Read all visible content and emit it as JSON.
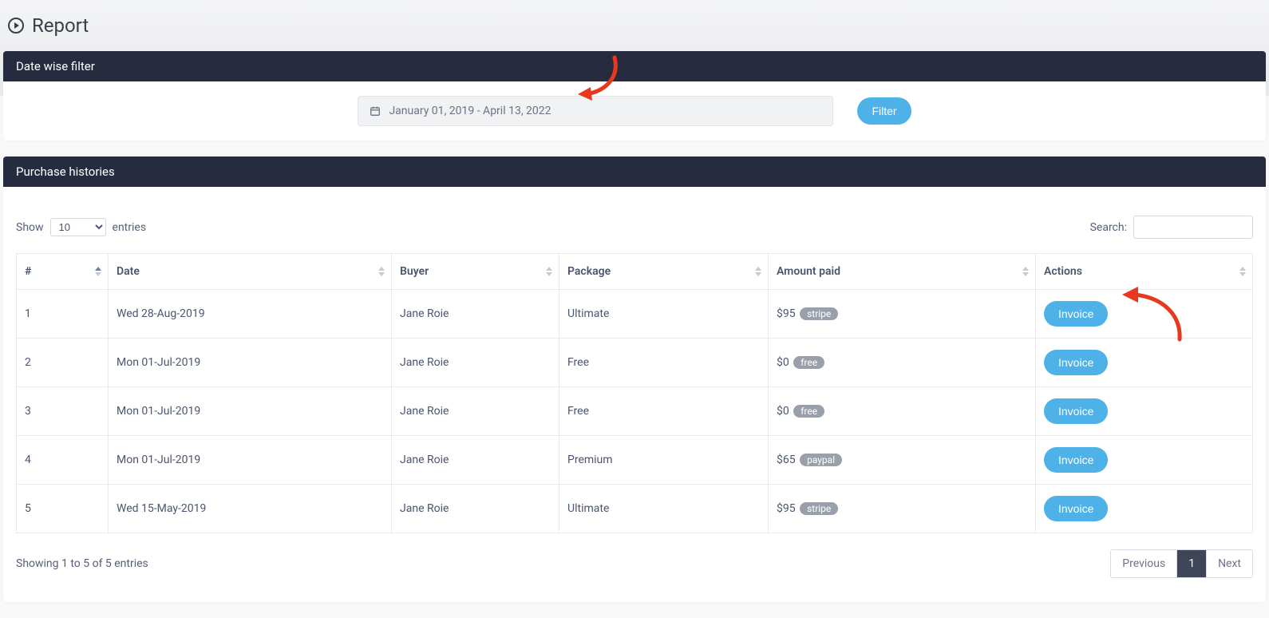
{
  "page": {
    "title": "Report"
  },
  "filter_card": {
    "header": "Date wise filter",
    "date_range": "January 01, 2019 - April 13, 2022",
    "button": "Filter"
  },
  "histories_card": {
    "header": "Purchase histories",
    "show_label_pre": "Show",
    "show_label_post": "entries",
    "show_value": "10",
    "search_label": "Search:",
    "columns": {
      "num": "#",
      "date": "Date",
      "buyer": "Buyer",
      "package": "Package",
      "amount": "Amount paid",
      "actions": "Actions"
    },
    "rows": [
      {
        "n": "1",
        "date": "Wed 28-Aug-2019",
        "buyer": "Jane Roie",
        "package": "Ultimate",
        "amount": "$95",
        "method": "stripe",
        "action": "Invoice"
      },
      {
        "n": "2",
        "date": "Mon 01-Jul-2019",
        "buyer": "Jane Roie",
        "package": "Free",
        "amount": "$0",
        "method": "free",
        "action": "Invoice"
      },
      {
        "n": "3",
        "date": "Mon 01-Jul-2019",
        "buyer": "Jane Roie",
        "package": "Free",
        "amount": "$0",
        "method": "free",
        "action": "Invoice"
      },
      {
        "n": "4",
        "date": "Mon 01-Jul-2019",
        "buyer": "Jane Roie",
        "package": "Premium",
        "amount": "$65",
        "method": "paypal",
        "action": "Invoice"
      },
      {
        "n": "5",
        "date": "Wed 15-May-2019",
        "buyer": "Jane Roie",
        "package": "Ultimate",
        "amount": "$95",
        "method": "stripe",
        "action": "Invoice"
      }
    ],
    "info": "Showing 1 to 5 of 5 entries",
    "pagination": {
      "prev": "Previous",
      "current": "1",
      "next": "Next"
    }
  },
  "colors": {
    "accent": "#4eb1e8",
    "header_dark": "#272b3f",
    "annotation": "#e6391f"
  }
}
